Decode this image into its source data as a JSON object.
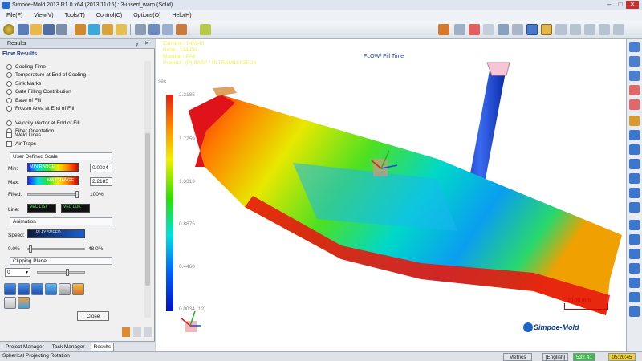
{
  "window": {
    "title": "Simpoe-Mold 2013 R1.0 x64  (2013/11/15) : 3-insert_warp (Solid)",
    "min": "–",
    "max": "□",
    "close": "✕"
  },
  "menu": [
    "File(F)",
    "View(V)",
    "Tools(T)",
    "Control(C)",
    "Options(O)",
    "Help(H)"
  ],
  "panel": {
    "title": "Results",
    "pin": "ᵩ ✕",
    "section": "Flow Results",
    "radios": [
      "Cooling Time",
      "Temperature at End of Cooling",
      "Sink Marks",
      "Gate Filling Contribution",
      "Ease of Fill",
      "Frozen Area at End of Fill",
      "Velocity Vector at End of Fill",
      "Fiber Orientation"
    ],
    "checks": [
      "Weld Lines",
      "Air Traps"
    ],
    "scale_group": "User Defined Scale",
    "min_label": "Min:",
    "min_value": "0.0034",
    "max_label": "Max:",
    "max_value": "2.2185",
    "min_bar_text": "MIN RANGE",
    "max_bar_text": "MAX RANGE",
    "filled_label": "Filled:",
    "filled_value": "100%",
    "line_label": "Line:",
    "line_btn1": "VEC LIST",
    "line_btn2": "VEC LOK",
    "animation_group": "Animation",
    "speed_label": "Speed:",
    "speed_bar_text": "PLAY SPEED",
    "speed_min": "0.0%",
    "speed_max": "48.0%",
    "clip_group": "Clipping Plane",
    "clip_value": "0",
    "close_button": "Close"
  },
  "tabs": [
    "Project Manager",
    "Task Manager",
    "Results"
  ],
  "viewport": {
    "info": [
      "Element :  246740",
      "Node :  144404",
      "Material :  PA6",
      "Product :  (P)  BASF / ULTRAMID B3EG6"
    ],
    "title": "FLOW/ Fill Time",
    "unit": "sec",
    "legend_values": [
      "2.2185",
      "1.7759",
      "1.3313",
      "0.8875",
      "0.4460",
      "0.0034 (12)"
    ],
    "scale_text": "20.00 mm",
    "brand": "Simpoe-Mold"
  },
  "status": {
    "text": "Spherical Projecting Rotation",
    "units": "Metrics",
    "lang": "[English]",
    "value": "532.41",
    "time": "05:20:45"
  },
  "colors": {
    "accent": "#1d6fd1",
    "legend_top": "#e81e10",
    "legend_bottom": "#0010c8",
    "info_text": "#f0f050",
    "title_text": "#1a33b0"
  }
}
